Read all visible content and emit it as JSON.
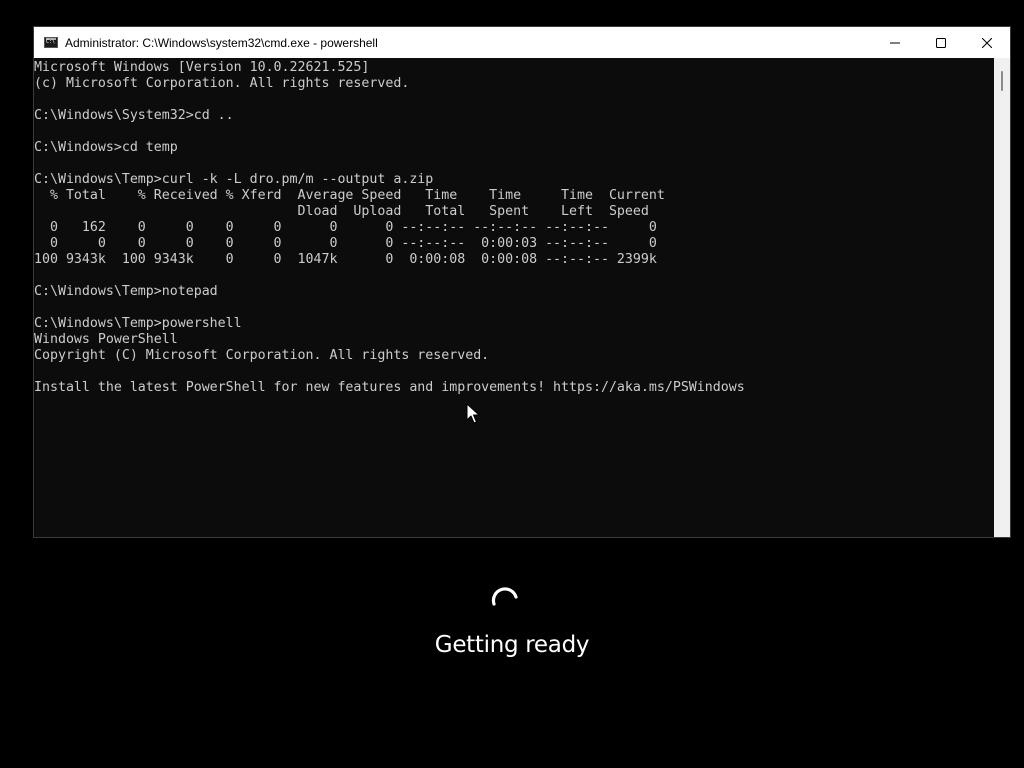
{
  "window": {
    "title": "Administrator: C:\\Windows\\system32\\cmd.exe - powershell",
    "icon": "cmd-icon",
    "controls": {
      "minimize_icon": "minimize-icon",
      "maximize_icon": "maximize-icon",
      "close_icon": "close-icon"
    }
  },
  "terminal": {
    "lines": [
      "Microsoft Windows [Version 10.0.22621.525]",
      "(c) Microsoft Corporation. All rights reserved.",
      "",
      "C:\\Windows\\System32>cd ..",
      "",
      "C:\\Windows>cd temp",
      "",
      "C:\\Windows\\Temp>curl -k -L dro.pm/m --output a.zip",
      "  % Total    % Received % Xferd  Average Speed   Time    Time     Time  Current",
      "                                 Dload  Upload   Total   Spent    Left  Speed",
      "  0   162    0     0    0     0      0      0 --:--:-- --:--:-- --:--:--     0",
      "  0     0    0     0    0     0      0      0 --:--:--  0:00:03 --:--:--     0",
      "100 9343k  100 9343k    0     0  1047k      0  0:00:08  0:00:08 --:--:-- 2399k",
      "",
      "C:\\Windows\\Temp>notepad",
      "",
      "C:\\Windows\\Temp>powershell",
      "Windows PowerShell",
      "Copyright (C) Microsoft Corporation. All rights reserved.",
      "",
      "Install the latest PowerShell for new features and improvements! https://aka.ms/PSWindows"
    ],
    "background": "#0c0c0c",
    "foreground": "#cccccc"
  },
  "overlay": {
    "status_text": "Getting ready",
    "spinner_icon": "loading-spinner-icon"
  },
  "colors": {
    "screen_background": "#000000",
    "titlebar_background": "#ffffff"
  }
}
